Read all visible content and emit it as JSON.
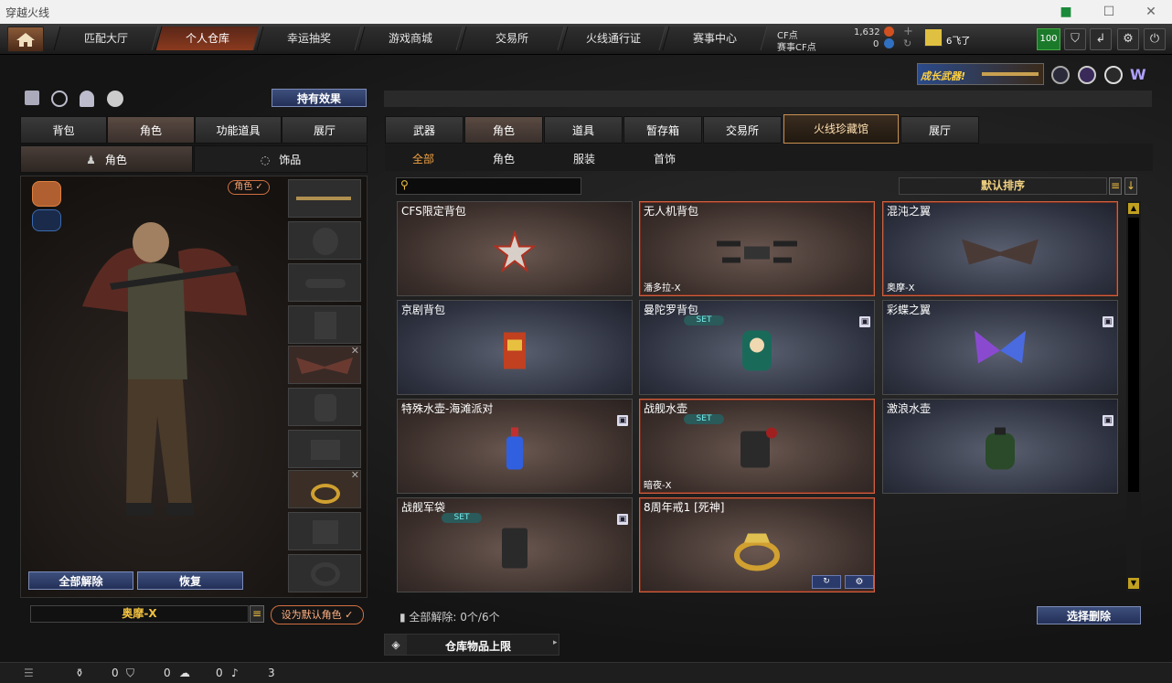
{
  "window": {
    "title": "穿越火线",
    "min": "—",
    "max": "☐",
    "close": "✕"
  },
  "nav": {
    "tabs": [
      {
        "label": "匹配大厅"
      },
      {
        "label": "个人仓库"
      },
      {
        "label": "幸运抽奖"
      },
      {
        "label": "游戏商城"
      },
      {
        "label": "交易所"
      },
      {
        "label": "火线通行证"
      },
      {
        "label": "赛事中心"
      }
    ],
    "cf_label": "CF点",
    "cf_value": "1,632",
    "cfs_label": "赛事CF点",
    "cfs_value": "0",
    "username": "6飞了",
    "level": "100"
  },
  "banner": {
    "text": "成长武器!"
  },
  "left": {
    "effects_button": "持有效果",
    "tabs": [
      "背包",
      "角色",
      "功能道具",
      "展厅"
    ],
    "subtabs": [
      "角色",
      "饰品"
    ],
    "role_badge": "角色 ✓",
    "release_all": "全部解除",
    "restore": "恢复",
    "char_name": "奥摩-X",
    "set_default": "设为默认角色 ✓"
  },
  "right": {
    "tabs": [
      "武器",
      "角色",
      "道具",
      "暂存箱",
      "交易所",
      "火线珍藏馆",
      "展厅"
    ],
    "subtabs": [
      "全部",
      "角色",
      "服装",
      "首饰"
    ],
    "search_placeholder": "",
    "sort": "默认排序",
    "items": [
      {
        "name": "CFS限定背包",
        "owner": "",
        "set": false,
        "lock": false,
        "style": "brown",
        "sel": false,
        "icon": "star-badge-icon"
      },
      {
        "name": "无人机背包",
        "owner": "潘多拉-X",
        "set": false,
        "lock": false,
        "style": "brown",
        "sel": true,
        "icon": "drone-icon"
      },
      {
        "name": "混沌之翼",
        "owner": "奥摩-X",
        "set": false,
        "lock": false,
        "style": "blue",
        "sel": true,
        "icon": "bat-wings-icon"
      },
      {
        "name": "京剧背包",
        "owner": "",
        "set": false,
        "lock": false,
        "style": "blue",
        "sel": false,
        "icon": "opera-backpack-icon"
      },
      {
        "name": "曼陀罗背包",
        "owner": "",
        "set": true,
        "lock": true,
        "style": "blue",
        "sel": false,
        "icon": "doll-backpack-icon"
      },
      {
        "name": "彩蝶之翼",
        "owner": "",
        "set": false,
        "lock": true,
        "style": "blue",
        "sel": false,
        "icon": "butterfly-wings-icon"
      },
      {
        "name": "特殊水壶-海滩派对",
        "owner": "",
        "set": false,
        "lock": true,
        "style": "brown",
        "sel": false,
        "icon": "bottle-icon"
      },
      {
        "name": "战舰水壶",
        "owner": "暗夜-X",
        "set": true,
        "lock": false,
        "style": "brown",
        "sel": true,
        "icon": "kettle-icon"
      },
      {
        "name": "激浪水壶",
        "owner": "",
        "set": false,
        "lock": true,
        "style": "blue",
        "sel": false,
        "icon": "canteen-icon"
      },
      {
        "name": "战舰军袋",
        "owner": "",
        "set": true,
        "lock": true,
        "style": "brown",
        "sel": false,
        "icon": "pouch-icon"
      },
      {
        "name": "8周年戒1 [死神]",
        "owner": "",
        "set": false,
        "lock": false,
        "style": "brown",
        "sel": true,
        "icon": "ring-icon"
      }
    ],
    "set_badge": "SET",
    "release_status": "全部解除: 0个/6个",
    "select_delete": "选择删除",
    "storage_limit": "仓库物品上限"
  },
  "status": {
    "v1": "0",
    "v2": "0",
    "v3": "0",
    "v4": "3"
  }
}
